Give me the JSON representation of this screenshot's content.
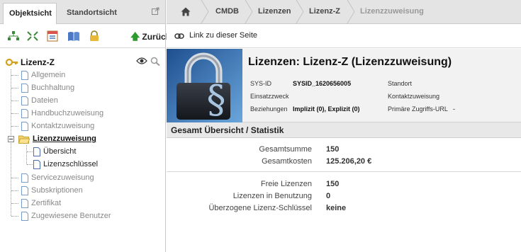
{
  "left_panel": {
    "tabs": [
      {
        "label": "Objektsicht",
        "active": true
      },
      {
        "label": "Standortsicht",
        "active": false
      }
    ],
    "toolbar": {
      "icons": [
        "tree-expand-icon",
        "tree-collapse-icon",
        "calendar-icon",
        "book-icon",
        "lock-icon"
      ],
      "back_label": "Zurück"
    },
    "tree": {
      "root_label": "Lizenz-Z",
      "items": [
        {
          "label": "Allgemein"
        },
        {
          "label": "Buchhaltung"
        },
        {
          "label": "Dateien"
        },
        {
          "label": "Handbuchzuweisung"
        },
        {
          "label": "Kontaktzuweisung"
        },
        {
          "label": "Lizenzzuweisung",
          "selected": true,
          "expanded": true,
          "children": [
            {
              "label": "Übersicht"
            },
            {
              "label": "Lizenzschlüssel"
            }
          ]
        },
        {
          "label": "Servicezuweisung"
        },
        {
          "label": "Subskriptionen"
        },
        {
          "label": "Zertifikat"
        },
        {
          "label": "Zugewiesene Benutzer"
        }
      ]
    }
  },
  "breadcrumb": [
    "CMDB",
    "Lizenzen",
    "Lizenz-Z",
    "Lizenzzuweisung"
  ],
  "link_bar": {
    "label": "Link zu dieser Seite"
  },
  "object_header": {
    "title": "Lizenzen: Lizenz-Z (Lizenzzuweisung)",
    "attributes": [
      {
        "label": "SYS-ID",
        "value": "SYSID_1620656005"
      },
      {
        "label": "Einsatzzweck",
        "value": ""
      },
      {
        "label": "Beziehungen",
        "value": "Implizit (0), Explizit (0)"
      }
    ],
    "attributes_right": [
      {
        "label": "Standort",
        "value": ""
      },
      {
        "label": "Kontaktzuweisung",
        "value": ""
      },
      {
        "label": "Primäre Zugriffs-URL",
        "value": "-"
      }
    ]
  },
  "section": {
    "title": "Gesamt Übersicht / Statistik",
    "group1": [
      {
        "label": "Gesamtsumme",
        "value": "150"
      },
      {
        "label": "Gesamtkosten",
        "value": "125.206,20 €"
      }
    ],
    "group2": [
      {
        "label": "Freie Lizenzen",
        "value": "150"
      },
      {
        "label": "Lizenzen in Benutzung",
        "value": "0"
      },
      {
        "label": "Überzogene Lizenz-Schlüssel",
        "value": "keine"
      }
    ]
  }
}
